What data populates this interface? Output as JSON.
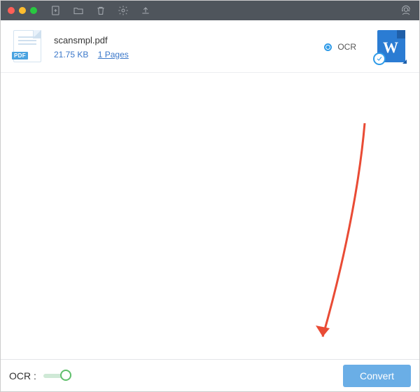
{
  "file": {
    "name": "scansmpl.pdf",
    "size": "21.75 KB",
    "pages": "1 Pages",
    "badge": "PDF",
    "ocr_tag": "OCR",
    "word_letter": "W"
  },
  "bottom": {
    "ocr_label": "OCR :",
    "convert_label": "Convert"
  }
}
